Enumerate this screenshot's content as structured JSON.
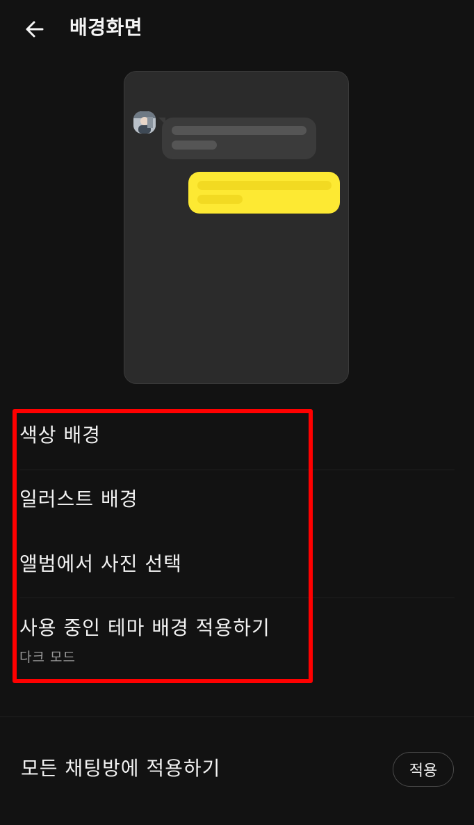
{
  "header": {
    "back_icon": "arrow-left-icon",
    "title": "배경화면"
  },
  "preview": {
    "received_bubble_color": "#3b3b3b",
    "sent_bubble_color": "#fde933",
    "background_color": "#2b2b2b"
  },
  "menu": {
    "items": [
      {
        "label": "색상 배경"
      },
      {
        "label": "일러스트 배경"
      },
      {
        "label": "앨범에서 사진 선택"
      },
      {
        "label": "사용 중인 테마 배경 적용하기",
        "sublabel": "다크 모드"
      }
    ]
  },
  "highlight": {
    "color": "#ff0000"
  },
  "footer": {
    "apply_all_label": "모든 채팅방에 적용하기",
    "apply_button_label": "적용"
  }
}
